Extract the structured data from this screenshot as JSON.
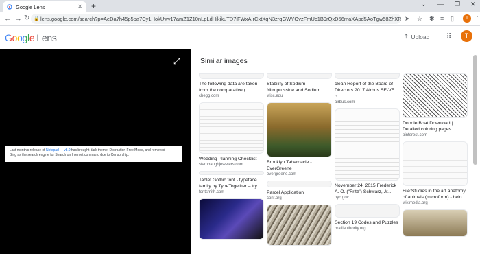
{
  "browser": {
    "tab_title": "Google Lens",
    "url": "lens.google.com/search?p=AeDa7h45p5pa7Cy1HokUwv17amZ1Z10nLpLdHikikuTD7iFWxAIrCxtXqN3zrqGWYOvzFmUc1B9rQxD56maXApd5AoTgw58ZhXRCCk..."
  },
  "header": {
    "logo_google": "Google",
    "logo_lens": "Lens",
    "upload_label": "Upload",
    "avatar_letter": "T"
  },
  "left": {
    "clip_line1_a": "Last month's release of ",
    "clip_line1_link": "Notepad++ v8.0",
    "clip_line1_b": " has brought dark theme, Distraction Free Mode, and removed",
    "clip_line2": "Bing as the search engine for Search on Internet command due to Censorship."
  },
  "results": {
    "title": "Similar images",
    "columns": [
      [
        {
          "title": "The following data are taken from the comparative (...",
          "source": "chegg.com"
        },
        {
          "title": "Wedding Planning Checklist",
          "source": "stambaughjewelers.com"
        },
        {
          "title": "Tablet Gothic font - typeface family by TypeTogether – try...",
          "source": "fontsmith.com"
        },
        {
          "title": "",
          "source": ""
        }
      ],
      [
        {
          "title": "Stability of Sodium Nitroprusside and Sodium...",
          "source": "wisc.edu"
        },
        {
          "title": "Brooklyn Tabernacle - EverGreene",
          "source": "evergreene.com"
        },
        {
          "title": "Parcel Application",
          "source": "conf.org"
        },
        {
          "title": "",
          "source": ""
        }
      ],
      [
        {
          "title": "clean Report of the Board of Directors 2017 Airbus SE-VF o...",
          "source": "airbus.com"
        },
        {
          "title": "November 24, 2015 Frederick A. O. (\"Fritz\") Schwarz, Jr...",
          "source": "nyc.gov"
        },
        {
          "title": "Section 19 Codes and Puzzles",
          "source": "braillauthority.org"
        }
      ],
      [
        {
          "title": "Doodle Boat Download | Detailed coloring pages...",
          "source": "pinterest.com"
        },
        {
          "title": "File:Studies in the art anatomy of animals (microform) - bein...",
          "source": "wikimedia.org"
        },
        {
          "title": "",
          "source": ""
        }
      ]
    ]
  },
  "colors": {
    "accent": "#1a73e8",
    "avatar": "#e8710a",
    "left_pane": "#000000"
  }
}
